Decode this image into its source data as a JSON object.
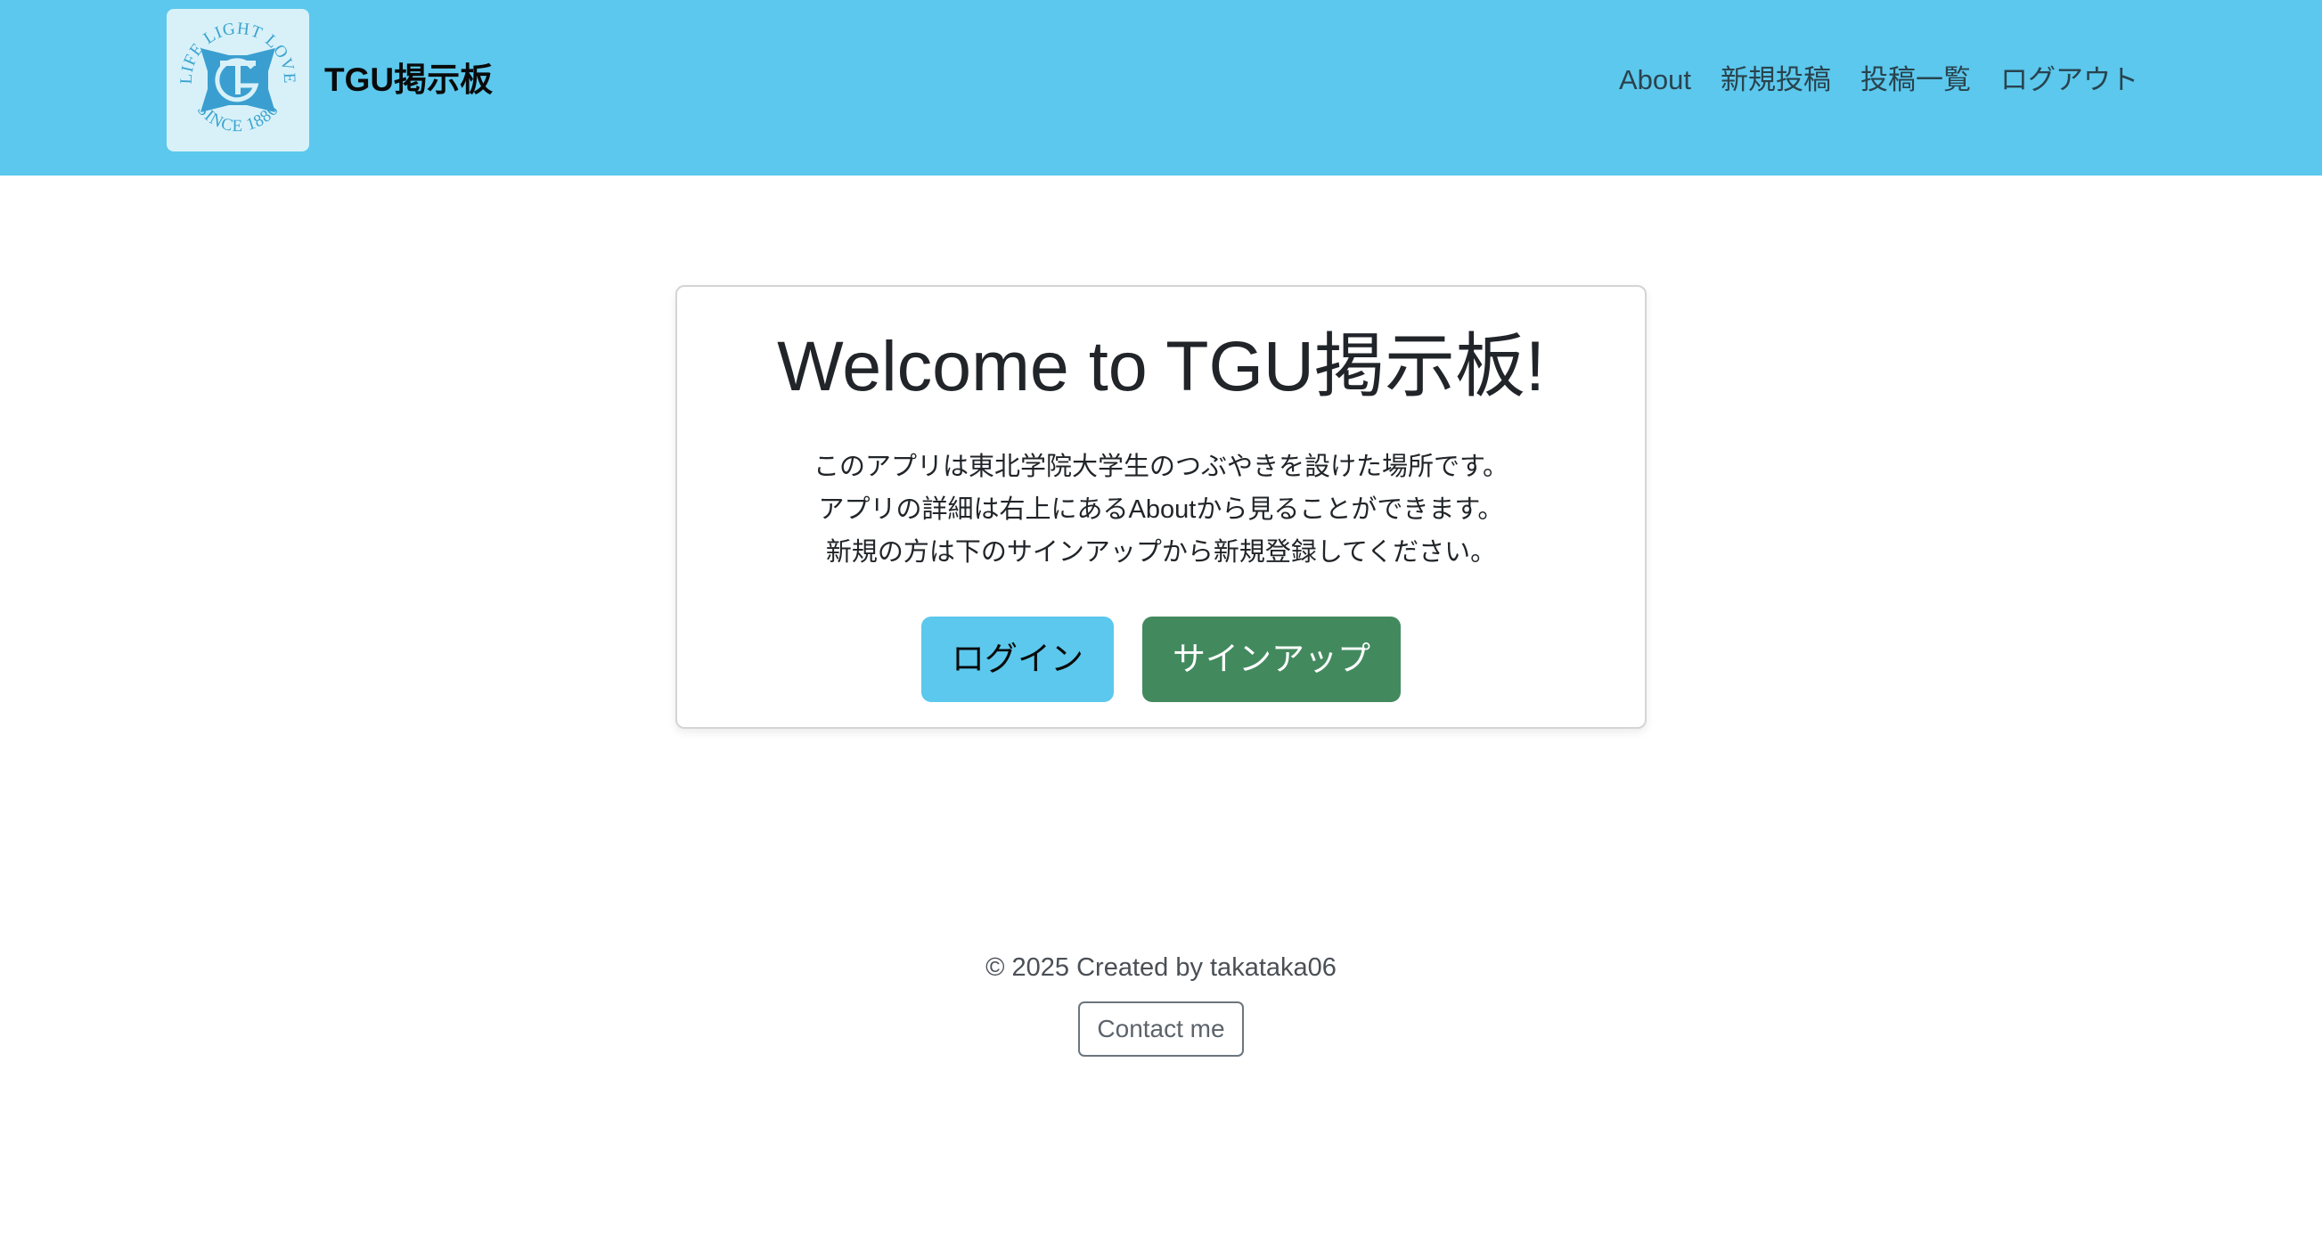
{
  "navbar": {
    "background": "#5cc8ed",
    "logo": {
      "icon": "tgu-seal-logo",
      "motto": "LIFE LIGHT LOVE",
      "since": "SINCE 1886"
    },
    "brand": "TGU掲示板",
    "links": [
      {
        "label": "About"
      },
      {
        "label": "新規投稿"
      },
      {
        "label": "投稿一覧"
      },
      {
        "label": "ログアウト"
      }
    ]
  },
  "welcome": {
    "title": "Welcome to TGU掲示板!",
    "lines": [
      "このアプリは東北学院大学生のつぶやきを設けた場所です。",
      "アプリの詳細は右上にあるAboutから見ることができます。",
      "新規の方は下のサインアップから新規登録してください。"
    ],
    "login_label": "ログイン",
    "signup_label": "サインアップ",
    "login_color": "#5cc8ed",
    "signup_color": "#428a5e"
  },
  "footer": {
    "copyright": "© 2025 Created by takataka06",
    "contact_label": "Contact me"
  }
}
